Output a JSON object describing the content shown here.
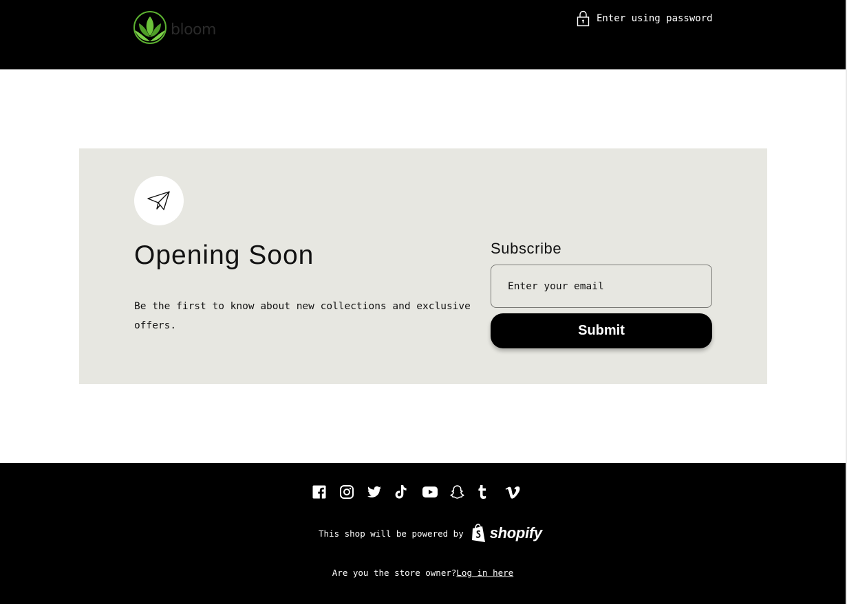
{
  "header": {
    "logo_text": "bloom",
    "password_link_label": "Enter using password"
  },
  "hero": {
    "heading": "Opening Soon",
    "tagline": "Be the first to know about new collections and exclusive offers.",
    "subscribe_label": "Subscribe",
    "email_placeholder": "Enter your email",
    "submit_label": "Submit"
  },
  "footer": {
    "socials": [
      {
        "name": "Facebook",
        "icon": "facebook-icon"
      },
      {
        "name": "Instagram",
        "icon": "instagram-icon"
      },
      {
        "name": "Twitter",
        "icon": "twitter-icon"
      },
      {
        "name": "TikTok",
        "icon": "tiktok-icon"
      },
      {
        "name": "YouTube",
        "icon": "youtube-icon"
      },
      {
        "name": "Snapchat",
        "icon": "snapchat-icon"
      },
      {
        "name": "Tumblr",
        "icon": "tumblr-icon"
      },
      {
        "name": "Vimeo",
        "icon": "vimeo-icon"
      }
    ],
    "powered_text": "This shop will be powered by",
    "shopify_text": "shopify",
    "owner_question": "Are you the store owner?",
    "login_link": "Log in here"
  },
  "colors": {
    "header_bg": "#000000",
    "panel_bg": "#e7e7e1",
    "logo_green": "#5bb030",
    "text": "#121212"
  }
}
